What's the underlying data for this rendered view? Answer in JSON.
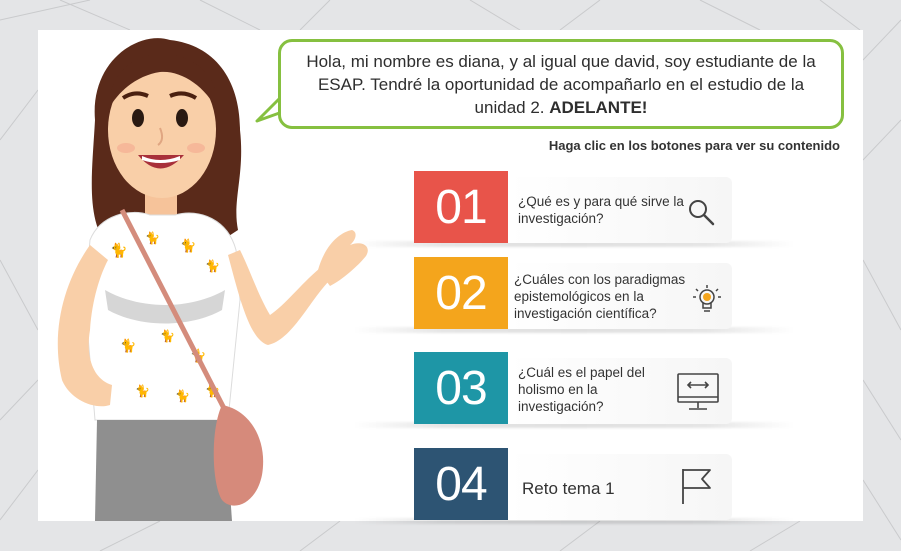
{
  "speech_bubble": {
    "text": "Hola, mi nombre es diana, y al  igual que david, soy estudiante de la ESAP. Tendré la oportunidad de acompañarlo en el estudio de la unidad 2.",
    "emphasis": "ADELANTE!"
  },
  "instruction": "Haga clic en los botones para ver su contenido",
  "menu": {
    "items": [
      {
        "number": "01",
        "label": "¿Qué es y para qué sirve la investigación?",
        "icon": "search-icon",
        "color": "#e8544a"
      },
      {
        "number": "02",
        "label": "¿Cuáles con los paradigmas epistemológicos en la investigación  científica?",
        "icon": "lightbulb-icon",
        "color": "#f4a51c"
      },
      {
        "number": "03",
        "label": "¿Cuál es el papel del holismo en la investigación?",
        "icon": "monitor-icon",
        "color": "#1e96a6"
      },
      {
        "number": "04",
        "label": "Reto tema 1",
        "icon": "flag-icon",
        "color": "#2d5473"
      }
    ]
  },
  "colors": {
    "bubble_border": "#86c040",
    "background": "#e4e5e7"
  }
}
